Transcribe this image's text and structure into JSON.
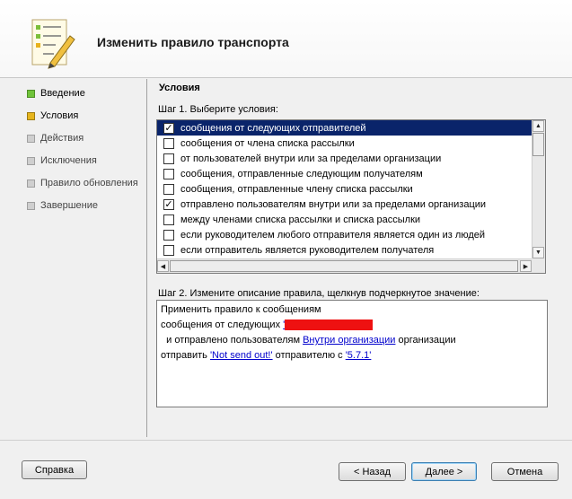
{
  "window": {
    "title": "Изменить правило транспорта"
  },
  "nav": {
    "items": [
      {
        "label": "Введение",
        "state": "done"
      },
      {
        "label": "Условия",
        "state": "active"
      },
      {
        "label": "Действия",
        "state": "pending"
      },
      {
        "label": "Исключения",
        "state": "pending"
      },
      {
        "label": "Правило обновления",
        "state": "pending"
      },
      {
        "label": "Завершение",
        "state": "pending"
      }
    ]
  },
  "main": {
    "section_title": "Условия",
    "step1_label": "Шаг 1. Выберите условия:",
    "conditions": [
      {
        "label": "сообщения от следующих отправителей",
        "checked": true,
        "selected": true
      },
      {
        "label": "сообщения от члена списка рассылки",
        "checked": false,
        "selected": false
      },
      {
        "label": "от пользователей внутри или за пределами организации",
        "checked": false,
        "selected": false
      },
      {
        "label": "сообщения, отправленные следующим получателям",
        "checked": false,
        "selected": false
      },
      {
        "label": "сообщения, отправленные члену списка рассылки",
        "checked": false,
        "selected": false
      },
      {
        "label": "отправлено пользователям внутри или за пределами организации",
        "checked": true,
        "selected": false
      },
      {
        "label": "между членами списка рассылки и списка рассылки",
        "checked": false,
        "selected": false
      },
      {
        "label": "если руководителем любого отправителя является один из людей",
        "checked": false,
        "selected": false
      },
      {
        "label": "если отправитель является руководителем получателя",
        "checked": false,
        "selected": false
      }
    ],
    "step2_label": "Шаг 2. Измените описание правила, щелкнув подчеркнутое значение:",
    "description": {
      "line1": "Применить правило к сообщениям",
      "line2_prefix": "сообщения от следующих",
      "line3_prefix": "  и отправлено пользователям",
      "line3_link": "Внутри организации",
      "line3_suffix": "организации",
      "line4_prefix": "отправить",
      "line4_link1": "'Not send out!'",
      "line4_mid": "отправителю с",
      "line4_link2": "'5.7.1'"
    }
  },
  "buttons": {
    "help": "Справка",
    "back": "< Назад",
    "next": "Далее >",
    "cancel": "Отмена"
  },
  "colors": {
    "selection": "#0a246a",
    "link": "#0000cc",
    "redaction": "#ee1111"
  }
}
